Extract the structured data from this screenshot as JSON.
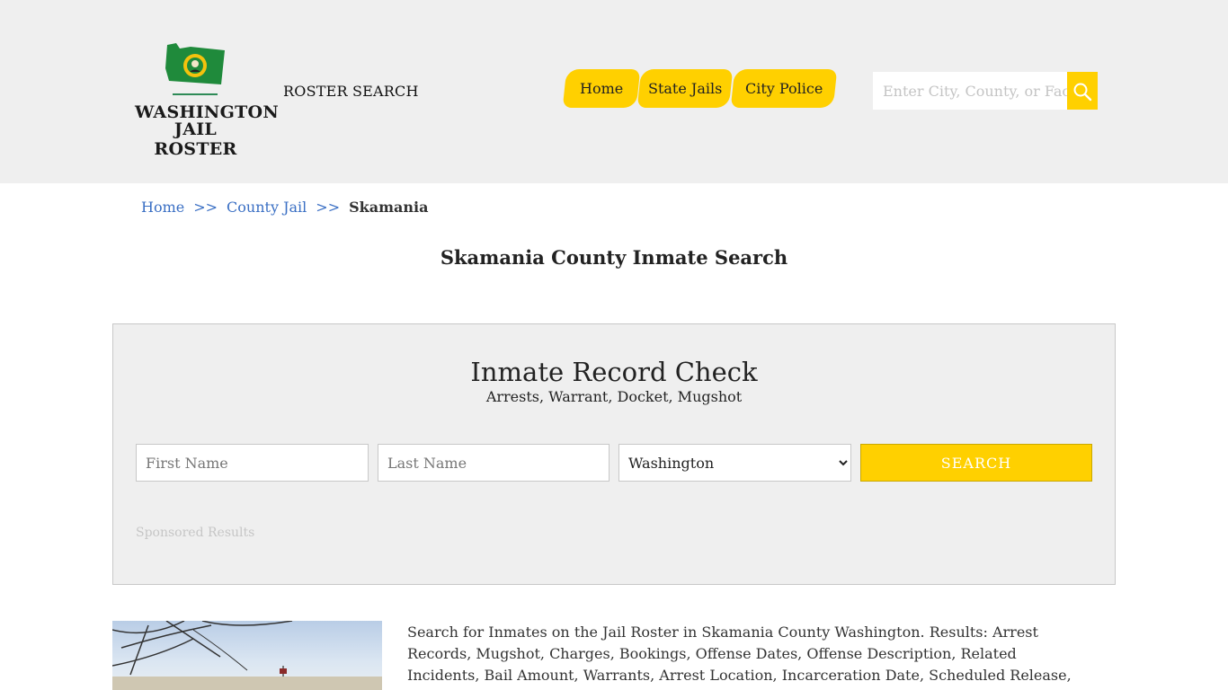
{
  "header": {
    "logo": {
      "line1": "WASHINGTON",
      "line2": "JAIL ROSTER",
      "icon": "washington-state-flag-icon"
    },
    "roster_search_label": "ROSTER SEARCH",
    "nav": [
      {
        "label": "Home"
      },
      {
        "label": "State Jails"
      },
      {
        "label": "City Police"
      }
    ],
    "search": {
      "placeholder": "Enter City, County, or Facility",
      "icon": "search-icon"
    }
  },
  "breadcrumb": {
    "items": [
      "Home",
      "County Jail"
    ],
    "separator": ">>",
    "current": "Skamania"
  },
  "page_title": "Skamania County Inmate Search",
  "record_check": {
    "title": "Inmate Record Check",
    "subtitle": "Arrests, Warrant, Docket, Mugshot",
    "first_name_placeholder": "First Name",
    "last_name_placeholder": "Last Name",
    "state_selected": "Washington",
    "search_label": "SEARCH",
    "sponsored_label": "Sponsored Results"
  },
  "description": "Search for Inmates on the Jail Roster in Skamania County Washington. Results: Arrest Records, Mugshot, Charges, Bookings, Offense Dates, Offense Description, Related Incidents, Bail Amount, Warrants, Arrest Location, Incarceration Date, Scheduled Release, Jail Housing Location, Court.",
  "colors": {
    "accent": "#ffd000",
    "header_bg": "#efefef",
    "link": "#3a6fc4"
  }
}
